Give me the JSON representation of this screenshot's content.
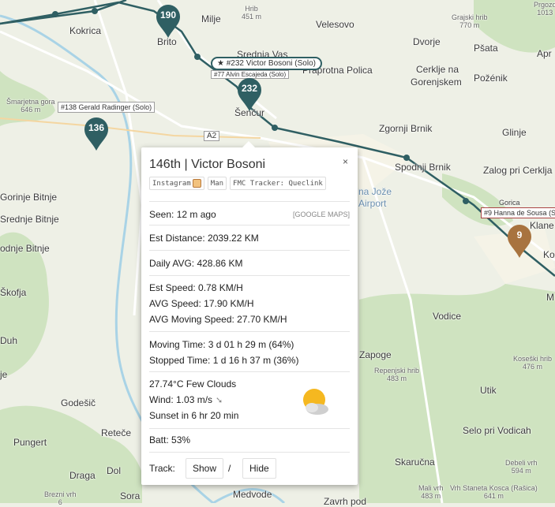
{
  "map": {
    "places": [
      {
        "name": "Kokrica"
      },
      {
        "name": "Brito"
      },
      {
        "name": "Milje"
      },
      {
        "name": "Velesovo"
      },
      {
        "name": "Srednja Vas"
      },
      {
        "name": "Dvorje"
      },
      {
        "name": "Šenčur"
      },
      {
        "name": "Praprotna Polica"
      },
      {
        "name": "Cerklje na"
      },
      {
        "name": "Gorenjskem"
      },
      {
        "name": "Pšata"
      },
      {
        "name": "Požénik"
      },
      {
        "name": "Apr"
      },
      {
        "name": "Zgornji Brnik"
      },
      {
        "name": "Glinje"
      },
      {
        "name": "Spodnji Brnik"
      },
      {
        "name": "Zalog pri Cerklja"
      },
      {
        "name": "Gorica"
      },
      {
        "name": "Klane"
      },
      {
        "name": "Ko"
      },
      {
        "name": "M"
      },
      {
        "name": "Vodice"
      },
      {
        "name": "Zapoge"
      },
      {
        "name": "Utik"
      },
      {
        "name": "Selo pri Vodicah"
      },
      {
        "name": "Skaručna"
      },
      {
        "name": "Medvode"
      },
      {
        "name": "Zavrh pod"
      },
      {
        "name": "Reteče"
      },
      {
        "name": "Draga"
      },
      {
        "name": "Sora"
      },
      {
        "name": "Pungert"
      },
      {
        "name": "Godešič"
      },
      {
        "name": "Duh"
      },
      {
        "name": "je"
      },
      {
        "name": "Gorinje Bitnje"
      },
      {
        "name": "Srednje Bitnje"
      },
      {
        "name": "odnje Bitnje"
      },
      {
        "name": "Dol"
      },
      {
        "name": "Škofja"
      }
    ],
    "peaks": [
      {
        "name": "Hrib",
        "elev": "451 m"
      },
      {
        "name": "Grajski hrib",
        "elev": "770 m"
      },
      {
        "name": "Prgozd",
        "elev": "1013"
      },
      {
        "name": "Šmarjetna gora",
        "elev": "646 m"
      },
      {
        "name": "Repenjski hrib",
        "elev": "483 m"
      },
      {
        "name": "Koseški hrib",
        "elev": "476 m"
      },
      {
        "name": "Debeli vrh",
        "elev": "594 m"
      },
      {
        "name": "Mali vrh",
        "elev": "483 m"
      },
      {
        "name": "Vrh Staneta Kosca (Rašica)",
        "elev": "641 m"
      },
      {
        "name": "Brezni vrh",
        "elev": "6"
      }
    ],
    "road_label": "A2",
    "airport_label": "na Jože",
    "airport_label2": "Airport",
    "pins": [
      {
        "number": "190",
        "color": "#2f5f63"
      },
      {
        "number": "232",
        "color": "#2f5f63"
      },
      {
        "number": "136",
        "color": "#2f5f63"
      },
      {
        "number": "9",
        "color": "#a8733f"
      }
    ],
    "rider_labels": {
      "selected": "★ #232 Victor Bosoni (Solo)",
      "behind": "#77 Alvin Escajeda (Solo)",
      "gerald": "#138 Gerald Radinger (Solo)",
      "hanna": "#9 Hanna de Sousa (Solo)"
    },
    "colors": {
      "track": "#2f5f63",
      "land": "#eef0e6",
      "forest": "#cfe3c0",
      "river": "#a9d3e6"
    }
  },
  "popup": {
    "title": "146th | Victor Bosoni",
    "close": "×",
    "tags": [
      "Instagram",
      "Man",
      "FMC Tracker: Queclink"
    ],
    "google_maps": "[GOOGLE MAPS]",
    "seen": "Seen: 12 m ago",
    "est_distance": "Est Distance: 2039.22 KM",
    "daily_avg": "Daily AVG: 428.86 KM",
    "est_speed": "Est Speed: 0.78 KM/H",
    "avg_speed": "AVG Speed: 17.90 KM/H",
    "avg_moving_speed": "AVG Moving Speed: 27.70 KM/H",
    "moving_time": "Moving Time: 3 d 01 h 29 m (64%)",
    "stopped_time": "Stopped Time: 1 d 16 h 37 m (36%)",
    "weather": "27.74°C Few Clouds",
    "wind": "Wind: 1.03 m/s",
    "sunset": "Sunset in 6 hr 20 min",
    "batt": "Batt: 53%",
    "track_label": "Track:",
    "show": "Show",
    "sep": "/",
    "hide": "Hide",
    "icons": {
      "weather": "sun-cloud-icon",
      "wind": "wind-direction-arrow-icon",
      "instagram": "instagram-icon"
    }
  }
}
